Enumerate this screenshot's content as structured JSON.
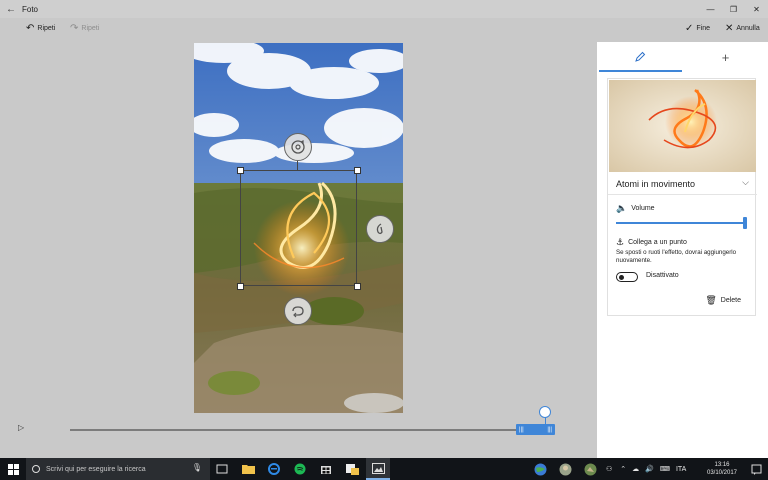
{
  "window": {
    "title": "Foto",
    "back_icon": "back-arrow-icon",
    "controls": [
      "minimize-icon",
      "maximize-icon",
      "close-icon"
    ]
  },
  "toolbar": {
    "undo_label": "Ripeti",
    "redo_label": "Ripeti",
    "done_label": "Fine",
    "cancel_label": "Annulla"
  },
  "panel": {
    "tabs": [
      {
        "icon": "pencil-icon",
        "active": true
      },
      {
        "icon": "plus-icon",
        "active": false
      }
    ],
    "effect": {
      "name": "Atomi in movimento",
      "volume_label": "Volume",
      "volume_level": 1.0,
      "anchor_label": "Collega a un punto",
      "anchor_note": "Se sposti o ruoti l'effetto, dovrai aggiungerlo nuovamente.",
      "toggle_state": "Disattivato",
      "toggle_on": false,
      "delete_label": "Delete"
    }
  },
  "timeline": {
    "play_icon": "play-icon",
    "playhead_fraction": 0.98
  },
  "taskbar": {
    "search_placeholder": "Scrivi qui per eseguire la ricerca",
    "language": "ITA",
    "time": "13:16",
    "date": "03/10/2017"
  },
  "colors": {
    "accent": "#3f86d8",
    "background": "#c9c9c9",
    "panel": "#ffffff",
    "taskbar": "#111418"
  }
}
